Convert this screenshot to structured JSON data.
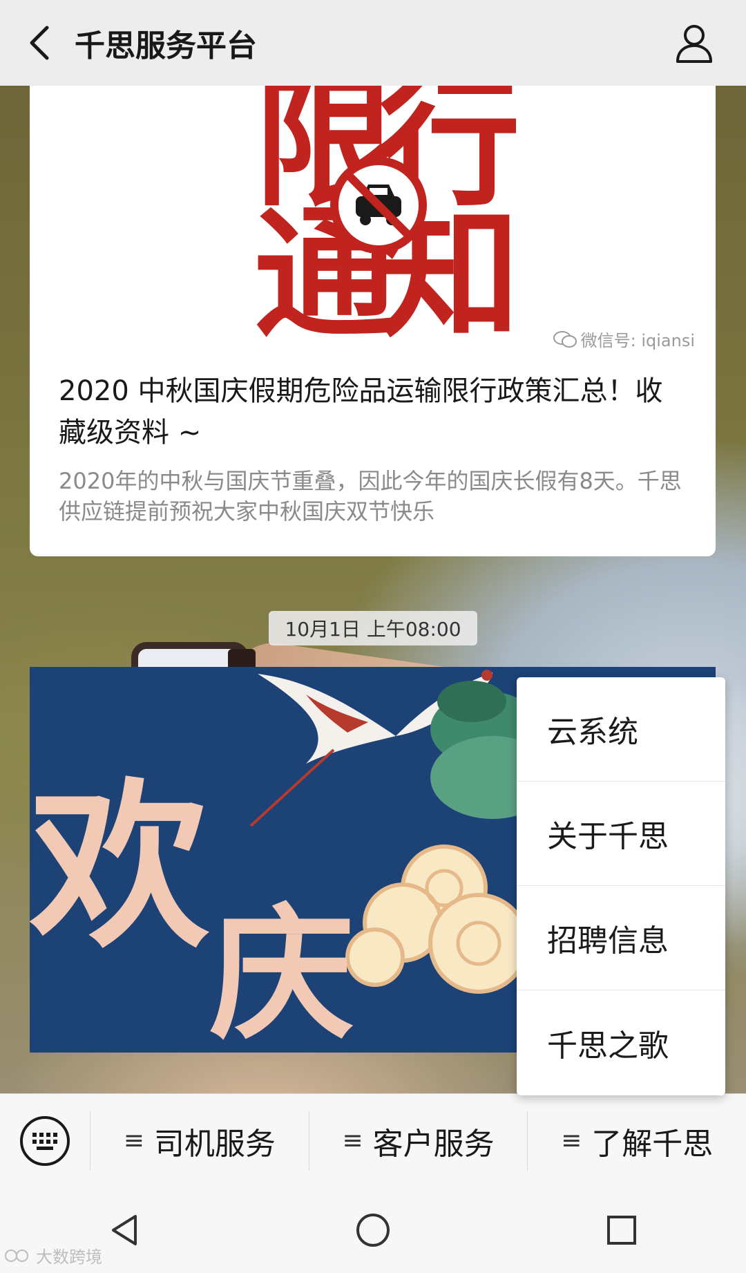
{
  "header": {
    "title": "千思服务平台",
    "back_icon": "chevron-left-icon",
    "profile_icon": "person-icon"
  },
  "card1": {
    "image_text": [
      "限",
      "行",
      "通",
      "知"
    ],
    "watermark": "微信号: iqiansi",
    "title": "2020 中秋国庆假期危险品运输限行政策汇总！收藏级资料 ~",
    "description": "2020年的中秋与国庆节重叠，因此今年的国庆长假有8天。千思供应链提前预祝大家中秋国庆双节快乐"
  },
  "timestamp": "10月1日 上午08:00",
  "card2": {
    "image_text": [
      "欢",
      "庆"
    ]
  },
  "submenu": {
    "items": [
      "云系统",
      "关于千思",
      "招聘信息",
      "千思之歌"
    ]
  },
  "menubar": {
    "keyboard_icon": "keyboard-icon",
    "items": [
      "司机服务",
      "客户服务",
      "了解千思"
    ],
    "menu_glyph": "≡"
  },
  "navbar": {
    "icons": [
      "back-triangle-icon",
      "home-circle-icon",
      "recents-square-icon"
    ]
  },
  "corner_watermark": "大数跨境",
  "colors": {
    "accent_red": "#c1231f",
    "card2_blue": "#1c4276"
  }
}
